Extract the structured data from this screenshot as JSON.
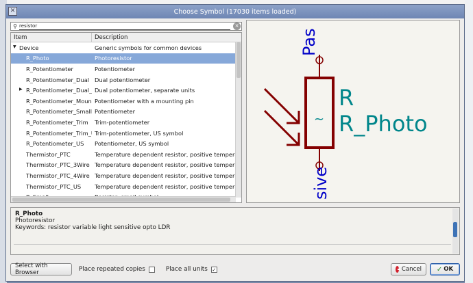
{
  "window": {
    "title": "Choose Symbol (17030 items loaded)"
  },
  "search": {
    "value": "resistor"
  },
  "tree": {
    "col_item": "Item",
    "col_desc": "Description",
    "rows": [
      {
        "item": "Device",
        "desc": "Generic symbols for common devices",
        "level": 0,
        "arrow": "▼"
      },
      {
        "item": "R_Photo",
        "desc": "Photoresistor",
        "level": 1,
        "selected": true
      },
      {
        "item": "R_Potentiometer",
        "desc": "Potentiometer",
        "level": 1
      },
      {
        "item": "R_Potentiometer_Dual",
        "desc": "Dual potentiometer",
        "level": 1
      },
      {
        "item": "R_Potentiometer_Dual_Separate",
        "desc": "Dual potentiometer, separate units",
        "level": 1,
        "arrow": "▶"
      },
      {
        "item": "R_Potentiometer_MountingPin",
        "desc": "Potentiometer with a mounting pin",
        "level": 1
      },
      {
        "item": "R_Potentiometer_Small",
        "desc": "Potentiometer",
        "level": 1
      },
      {
        "item": "R_Potentiometer_Trim",
        "desc": "Trim-potentiometer",
        "level": 1
      },
      {
        "item": "R_Potentiometer_Trim_US",
        "desc": "Trim-potentiometer, US symbol",
        "level": 1
      },
      {
        "item": "R_Potentiometer_US",
        "desc": "Potentiometer, US symbol",
        "level": 1
      },
      {
        "item": "Thermistor_PTC",
        "desc": "Temperature dependent resistor, positive temperature coefficient",
        "level": 1
      },
      {
        "item": "Thermistor_PTC_3Wire",
        "desc": "Temperature dependent resistor, positive temperature coefficient",
        "level": 1
      },
      {
        "item": "Thermistor_PTC_4Wire",
        "desc": "Temperature dependent resistor, positive temperature coefficient",
        "level": 1
      },
      {
        "item": "Thermistor_PTC_US",
        "desc": "Temperature dependent resistor, positive temperature coefficient",
        "level": 1
      },
      {
        "item": "R_Small",
        "desc": "Resistor, small symbol",
        "level": 1
      }
    ]
  },
  "preview": {
    "pin_top": "Pas",
    "pin_bottom": "sive",
    "ref": "R",
    "value": "R_Photo",
    "tilde": "~"
  },
  "details": {
    "name": "R_Photo",
    "description": "Photoresistor",
    "keywords": "Keywords: resistor variable light sensitive opto LDR"
  },
  "footer": {
    "browser_button": "Select with Browser",
    "repeat_label": "Place repeated copies",
    "all_units_label": "Place all units",
    "all_units_checked": "✓",
    "cancel": "Cancel",
    "ok": "OK"
  },
  "colors": {
    "selection": "#86a8d9",
    "symbol_body": "#840000",
    "symbol_text": "#00868b",
    "pin_text": "#0000c8"
  }
}
